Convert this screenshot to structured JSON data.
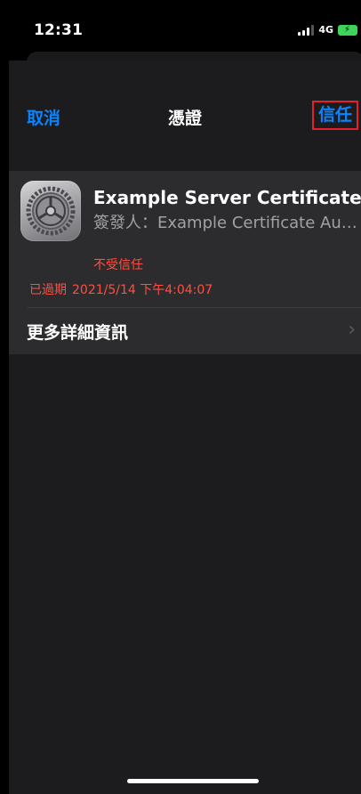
{
  "status_bar": {
    "time": "12:31",
    "network": "4G",
    "icons": [
      "signal-icon",
      "battery-charging-icon"
    ]
  },
  "nav": {
    "cancel_label": "取消",
    "title": "憑證",
    "trust_label": "信任"
  },
  "certificate": {
    "name": "Example Server Certificate",
    "issuer_label": "簽發人：",
    "issuer": "Example Certificate Aut...",
    "trust_status": "不受信任",
    "expired_label": "已過期",
    "expired_date": "2021/5/14 下午4:04:07",
    "icon": "settings-gear-icon"
  },
  "more_details": {
    "label": "更多詳細資訊"
  },
  "colors": {
    "accent": "#0a84ff",
    "danger": "#ff4f42",
    "highlight_box": "#e3202b",
    "background": "#000000",
    "sheet": "#1c1c1e",
    "card": "#2c2c2e"
  }
}
